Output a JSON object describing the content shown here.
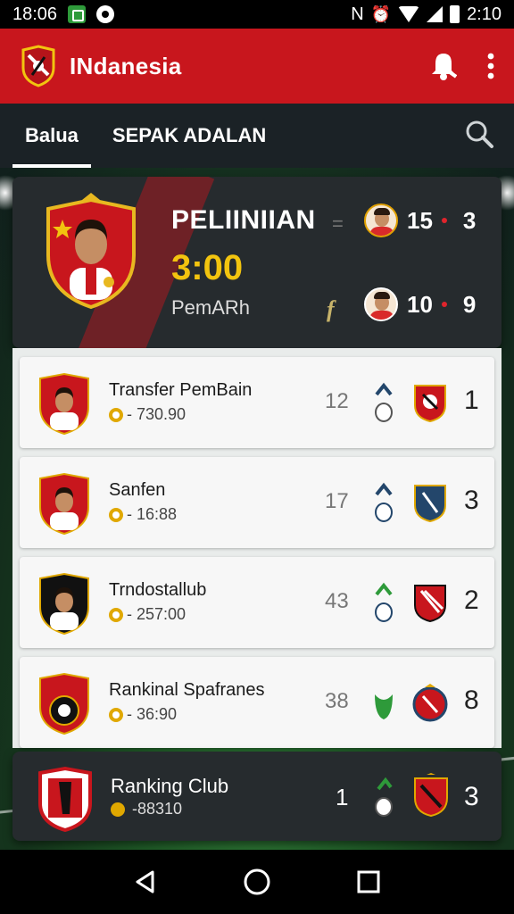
{
  "status_bar": {
    "time_left": "18:06",
    "icons": "N",
    "time_right": "2:10"
  },
  "app_bar": {
    "title": "INdanesia"
  },
  "tabs": [
    {
      "label": "Balua",
      "active": true
    },
    {
      "label": "SEPAK ADALAN",
      "active": false
    }
  ],
  "hero": {
    "title": "PELIINIIAN",
    "time": "3:00",
    "subtitle": "PemARh",
    "leaf_glyph": "f",
    "dash": "=",
    "team1": {
      "score": "15",
      "result": "3"
    },
    "team2": {
      "score": "10",
      "result": "9"
    }
  },
  "rows": [
    {
      "title": "Transfer PemBain",
      "meta": "- 730.90",
      "num": "12",
      "score": "1"
    },
    {
      "title": "Sanfen",
      "meta": "- 16:88",
      "num": "17",
      "score": "3"
    },
    {
      "title": "Trndostallub",
      "meta": "- 257:00",
      "num": "43",
      "score": "2"
    },
    {
      "title": "Rankinal Spafranes",
      "meta": "- 36:90",
      "num": "38",
      "score": "8"
    }
  ],
  "bottom_card": {
    "title": "Ranking Club",
    "meta": "-88310",
    "num": "1",
    "score": "3"
  },
  "colors": {
    "brand_red": "#c8161d",
    "accent_gold": "#f2c40f",
    "dark_card": "#262b2e"
  }
}
